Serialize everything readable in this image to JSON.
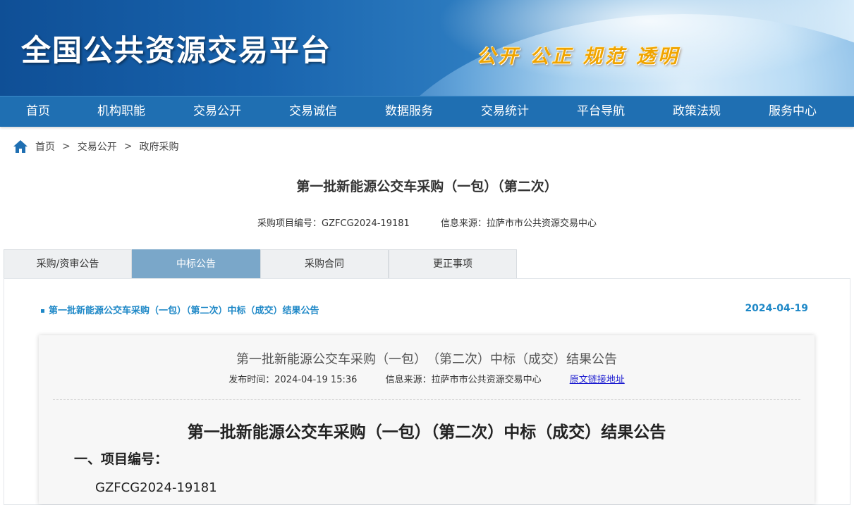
{
  "header": {
    "site_title": "全国公共资源交易平台",
    "slogan": "公开 公正 规范 透明"
  },
  "nav": {
    "items": [
      "首页",
      "机构职能",
      "交易公开",
      "交易诚信",
      "数据服务",
      "交易统计",
      "平台导航",
      "政策法规",
      "服务中心"
    ]
  },
  "breadcrumb": {
    "home": "首页",
    "level1": "交易公开",
    "level2": "政府采购",
    "separator": ">"
  },
  "project": {
    "title": "第一批新能源公交车采购（一包）（第二次）",
    "code_label": "采购项目编号：GZFCG2024-19181",
    "source_label": "信息来源：拉萨市市公共资源交易中心"
  },
  "tabs": [
    {
      "label": "采购/资审公告",
      "active": false
    },
    {
      "label": "中标公告",
      "active": true
    },
    {
      "label": "采购合同",
      "active": false
    },
    {
      "label": "更正事项",
      "active": false
    }
  ],
  "list": {
    "item_title": "第一批新能源公交车采购（一包）（第二次）中标（成交）结果公告",
    "item_date": "2024-04-19"
  },
  "document": {
    "header_title": "第一批新能源公交车采购（一包）　（第二次）中标（成交）结果公告",
    "publish_time": "发布时间：2024-04-19 15:36",
    "source": "信息来源：拉萨市市公共资源交易中心",
    "source_link": "原文链接地址",
    "title": "第一批新能源公交车采购（一包）（第二次）中标（成交）结果公告",
    "section1_heading": "一、项目编号：",
    "section1_value": "GZFCG2024-19181"
  },
  "colors": {
    "nav_bg": "#1f6fb2",
    "tab_active_bg": "#7aa7c9",
    "link": "#1e88c7"
  }
}
